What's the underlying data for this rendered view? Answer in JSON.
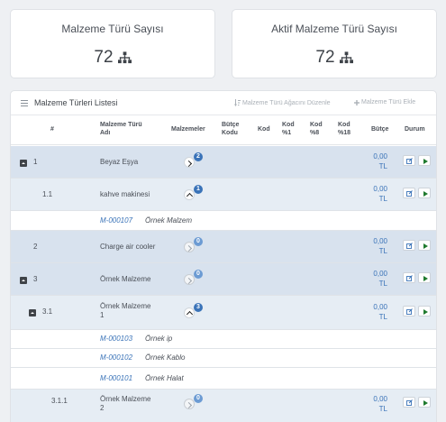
{
  "stats": {
    "total_label": "Malzeme Türü Sayısı",
    "total_value": "72",
    "active_label": "Aktif Malzeme Türü Sayısı",
    "active_value": "72",
    "icon": "sitemap-icon"
  },
  "panel": {
    "title": "Malzeme Türleri Listesi",
    "edit_tree_label": "Malzeme Türü Ağacını Düzenle",
    "add_label": "Malzeme Türü Ekle"
  },
  "columns": {
    "num": "#",
    "name_1": "Malzeme Türü",
    "name_2": "Adı",
    "materials": "Malzemeler",
    "budget_code_1": "Bütçe",
    "budget_code_2": "Kodu",
    "kod": "Kod",
    "kod1_1": "Kod",
    "kod1_2": "%1",
    "kod8_1": "Kod",
    "kod8_2": "%8",
    "kod18_1": "Kod",
    "kod18_2": "%18",
    "budget": "Bütçe",
    "status": "Durum"
  },
  "rows": [
    {
      "num": "1",
      "name": "Beyaz Eşya",
      "count": "2",
      "budget_1": "0,00",
      "budget_2": "TL"
    },
    {
      "num": "1.1",
      "name": "kahve makinesi",
      "count": "1",
      "budget_1": "0,00",
      "budget_2": "TL"
    },
    {
      "code": "M-000107",
      "name": "Örnek Malzem"
    },
    {
      "num": "2",
      "name": "Charge air cooler",
      "count": "0",
      "budget_1": "0,00",
      "budget_2": "TL"
    },
    {
      "num": "3",
      "name": "Örnek Malzeme",
      "count": "0",
      "budget_1": "0,00",
      "budget_2": "TL"
    },
    {
      "num": "3.1",
      "name_1": "Örnek Malzeme",
      "name_2": "1",
      "count": "3",
      "budget_1": "0,00",
      "budget_2": "TL"
    },
    {
      "code": "M-000103",
      "name": "Örnek ip"
    },
    {
      "code": "M-000102",
      "name": "Örnek Kablo"
    },
    {
      "code": "M-000101",
      "name": "Örnek Halat"
    },
    {
      "num": "3.1.1",
      "name_1": "Örnek Malzeme",
      "name_2": "2",
      "count": "0",
      "budget_1": "0,00",
      "budget_2": "TL"
    }
  ],
  "colors": {
    "accent": "#3a73b8",
    "row_dark": "#d8e2ee",
    "row_light": "#e6edf4",
    "play": "#1f7a2e"
  }
}
